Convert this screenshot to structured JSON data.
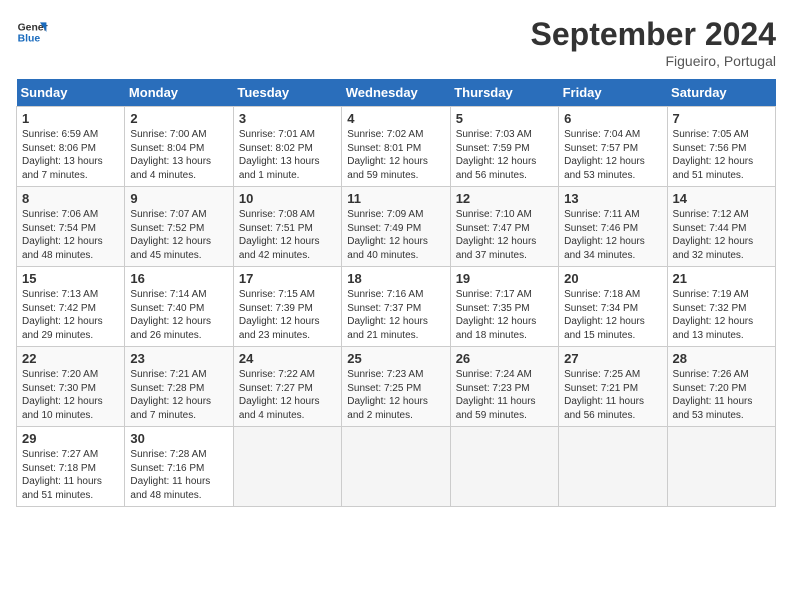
{
  "logo": {
    "line1": "General",
    "line2": "Blue"
  },
  "title": "September 2024",
  "location": "Figueiro, Portugal",
  "weekdays": [
    "Sunday",
    "Monday",
    "Tuesday",
    "Wednesday",
    "Thursday",
    "Friday",
    "Saturday"
  ],
  "weeks": [
    [
      {
        "day": 1,
        "sunrise": "6:59 AM",
        "sunset": "8:06 PM",
        "daylight": "13 hours and 7 minutes."
      },
      {
        "day": 2,
        "sunrise": "7:00 AM",
        "sunset": "8:04 PM",
        "daylight": "13 hours and 4 minutes."
      },
      {
        "day": 3,
        "sunrise": "7:01 AM",
        "sunset": "8:02 PM",
        "daylight": "13 hours and 1 minute."
      },
      {
        "day": 4,
        "sunrise": "7:02 AM",
        "sunset": "8:01 PM",
        "daylight": "12 hours and 59 minutes."
      },
      {
        "day": 5,
        "sunrise": "7:03 AM",
        "sunset": "7:59 PM",
        "daylight": "12 hours and 56 minutes."
      },
      {
        "day": 6,
        "sunrise": "7:04 AM",
        "sunset": "7:57 PM",
        "daylight": "12 hours and 53 minutes."
      },
      {
        "day": 7,
        "sunrise": "7:05 AM",
        "sunset": "7:56 PM",
        "daylight": "12 hours and 51 minutes."
      }
    ],
    [
      {
        "day": 8,
        "sunrise": "7:06 AM",
        "sunset": "7:54 PM",
        "daylight": "12 hours and 48 minutes."
      },
      {
        "day": 9,
        "sunrise": "7:07 AM",
        "sunset": "7:52 PM",
        "daylight": "12 hours and 45 minutes."
      },
      {
        "day": 10,
        "sunrise": "7:08 AM",
        "sunset": "7:51 PM",
        "daylight": "12 hours and 42 minutes."
      },
      {
        "day": 11,
        "sunrise": "7:09 AM",
        "sunset": "7:49 PM",
        "daylight": "12 hours and 40 minutes."
      },
      {
        "day": 12,
        "sunrise": "7:10 AM",
        "sunset": "7:47 PM",
        "daylight": "12 hours and 37 minutes."
      },
      {
        "day": 13,
        "sunrise": "7:11 AM",
        "sunset": "7:46 PM",
        "daylight": "12 hours and 34 minutes."
      },
      {
        "day": 14,
        "sunrise": "7:12 AM",
        "sunset": "7:44 PM",
        "daylight": "12 hours and 32 minutes."
      }
    ],
    [
      {
        "day": 15,
        "sunrise": "7:13 AM",
        "sunset": "7:42 PM",
        "daylight": "12 hours and 29 minutes."
      },
      {
        "day": 16,
        "sunrise": "7:14 AM",
        "sunset": "7:40 PM",
        "daylight": "12 hours and 26 minutes."
      },
      {
        "day": 17,
        "sunrise": "7:15 AM",
        "sunset": "7:39 PM",
        "daylight": "12 hours and 23 minutes."
      },
      {
        "day": 18,
        "sunrise": "7:16 AM",
        "sunset": "7:37 PM",
        "daylight": "12 hours and 21 minutes."
      },
      {
        "day": 19,
        "sunrise": "7:17 AM",
        "sunset": "7:35 PM",
        "daylight": "12 hours and 18 minutes."
      },
      {
        "day": 20,
        "sunrise": "7:18 AM",
        "sunset": "7:34 PM",
        "daylight": "12 hours and 15 minutes."
      },
      {
        "day": 21,
        "sunrise": "7:19 AM",
        "sunset": "7:32 PM",
        "daylight": "12 hours and 13 minutes."
      }
    ],
    [
      {
        "day": 22,
        "sunrise": "7:20 AM",
        "sunset": "7:30 PM",
        "daylight": "12 hours and 10 minutes."
      },
      {
        "day": 23,
        "sunrise": "7:21 AM",
        "sunset": "7:28 PM",
        "daylight": "12 hours and 7 minutes."
      },
      {
        "day": 24,
        "sunrise": "7:22 AM",
        "sunset": "7:27 PM",
        "daylight": "12 hours and 4 minutes."
      },
      {
        "day": 25,
        "sunrise": "7:23 AM",
        "sunset": "7:25 PM",
        "daylight": "12 hours and 2 minutes."
      },
      {
        "day": 26,
        "sunrise": "7:24 AM",
        "sunset": "7:23 PM",
        "daylight": "11 hours and 59 minutes."
      },
      {
        "day": 27,
        "sunrise": "7:25 AM",
        "sunset": "7:21 PM",
        "daylight": "11 hours and 56 minutes."
      },
      {
        "day": 28,
        "sunrise": "7:26 AM",
        "sunset": "7:20 PM",
        "daylight": "11 hours and 53 minutes."
      }
    ],
    [
      {
        "day": 29,
        "sunrise": "7:27 AM",
        "sunset": "7:18 PM",
        "daylight": "11 hours and 51 minutes."
      },
      {
        "day": 30,
        "sunrise": "7:28 AM",
        "sunset": "7:16 PM",
        "daylight": "11 hours and 48 minutes."
      },
      null,
      null,
      null,
      null,
      null
    ]
  ]
}
